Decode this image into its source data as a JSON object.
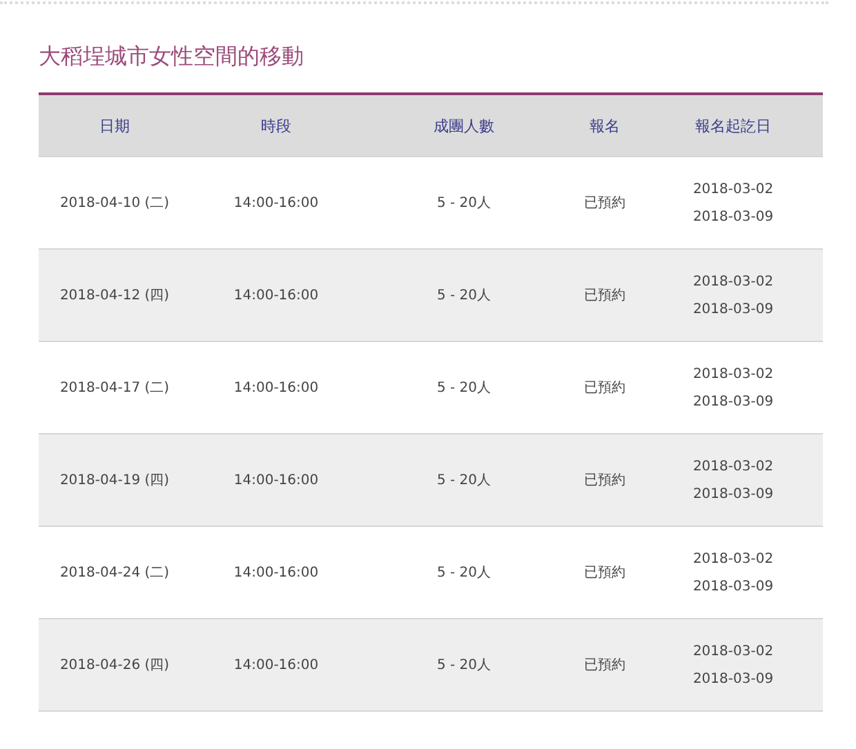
{
  "title": "大稻埕城市女性空間的移動",
  "table": {
    "columns": [
      "日期",
      "時段",
      "成團人數",
      "報名",
      "報名起訖日"
    ],
    "rows": [
      {
        "date": "2018-04-10 (二)",
        "time": "14:00-16:00",
        "group_size": "5 - 20人",
        "status": "已預約",
        "signup_start": "2018-03-02",
        "signup_end": "2018-03-09"
      },
      {
        "date": "2018-04-12 (四)",
        "time": "14:00-16:00",
        "group_size": "5 - 20人",
        "status": "已預約",
        "signup_start": "2018-03-02",
        "signup_end": "2018-03-09"
      },
      {
        "date": "2018-04-17 (二)",
        "time": "14:00-16:00",
        "group_size": "5 - 20人",
        "status": "已預約",
        "signup_start": "2018-03-02",
        "signup_end": "2018-03-09"
      },
      {
        "date": "2018-04-19 (四)",
        "time": "14:00-16:00",
        "group_size": "5 - 20人",
        "status": "已預約",
        "signup_start": "2018-03-02",
        "signup_end": "2018-03-09"
      },
      {
        "date": "2018-04-24 (二)",
        "time": "14:00-16:00",
        "group_size": "5 - 20人",
        "status": "已預約",
        "signup_start": "2018-03-02",
        "signup_end": "2018-03-09"
      },
      {
        "date": "2018-04-26 (四)",
        "time": "14:00-16:00",
        "group_size": "5 - 20人",
        "status": "已預約",
        "signup_start": "2018-03-02",
        "signup_end": "2018-03-09"
      }
    ]
  }
}
